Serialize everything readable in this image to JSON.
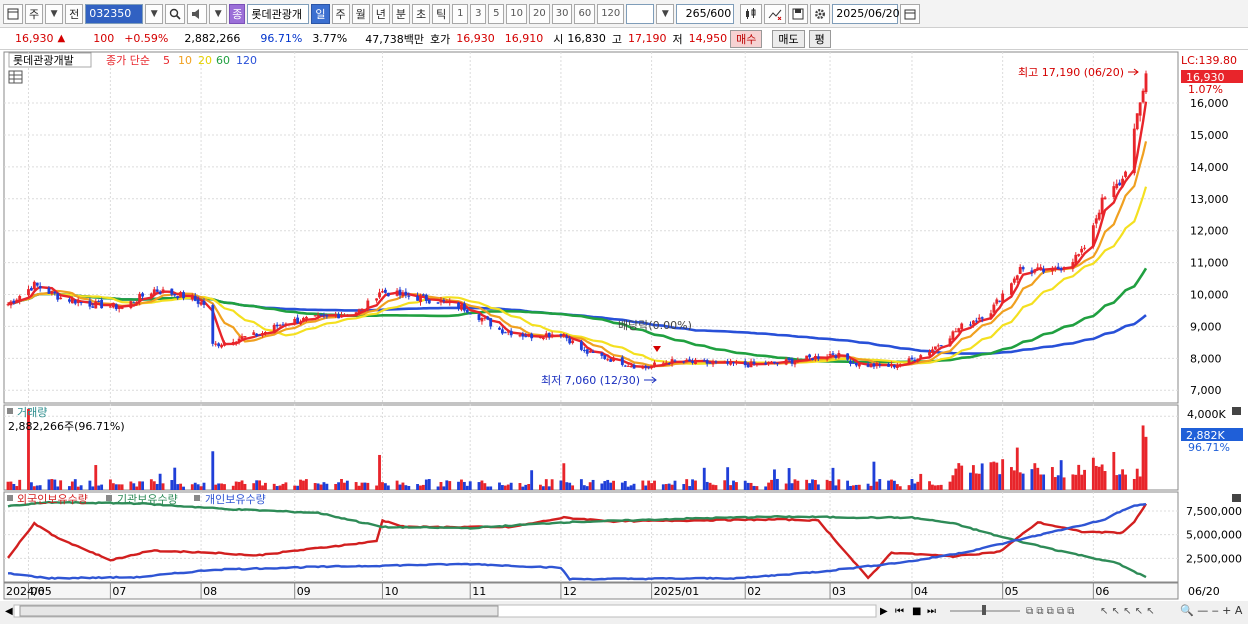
{
  "toolbar": {
    "type_label": "주",
    "prev_label": "전",
    "code": "032350",
    "name_badge": "종",
    "name": "롯데관광개",
    "period_tabs": [
      "일",
      "주",
      "월",
      "년",
      "분",
      "초",
      "틱"
    ],
    "active_period": "일",
    "intervals": [
      "1",
      "3",
      "5",
      "10",
      "20",
      "30",
      "60",
      "120"
    ],
    "count": "265",
    "count_total": "/600",
    "date": "2025/06/20"
  },
  "quote": {
    "price": "16,930",
    "change": "100",
    "change_pct": "+0.59%",
    "volume": "2,882,266",
    "vol_ratio": "96.71%",
    "turnover_rate": "3.77%",
    "trade_value": "47,738백만",
    "ask_label": "호가",
    "ask": "16,930",
    "bid": "16,910",
    "open_label": "시",
    "open": "16,830",
    "high_label": "고",
    "high": "17,190",
    "low_label": "저",
    "low": "14,950",
    "buy_label": "매수",
    "sell_label": "매도",
    "avg_label": "평"
  },
  "colors": {
    "up": "#e8252b",
    "down": "#1f3fd8",
    "ma5": "#e8252b",
    "ma10": "#f0a020",
    "ma20": "#f4e020",
    "ma60": "#20a040",
    "ma120": "#2850d8",
    "foreign": "#d21f1f",
    "institution": "#2e8b57",
    "individual": "#2f55d4"
  },
  "chart_data": [
    {
      "type": "candlestick",
      "legend": {
        "stock": "롯데관광개발",
        "ma_title": "종가 단순",
        "ma_periods": [
          "5",
          "10",
          "20",
          "60",
          "120"
        ]
      },
      "y_ticks": [
        "7,000",
        "8,000",
        "9,000",
        "10,000",
        "11,000",
        "12,000",
        "13,000",
        "14,000",
        "15,000",
        "16,000"
      ],
      "ylim": [
        6600,
        17600
      ],
      "right_labels": {
        "lc": "LC:139.80",
        "price_tag": "16,930",
        "pct": "1.07%"
      },
      "x_ticks": [
        "2024/05",
        "06",
        "07",
        "08",
        "09",
        "10",
        "11",
        "12",
        "2025/01",
        "02",
        "03",
        "04",
        "05",
        "06"
      ],
      "annotations": {
        "high": "최고 17,190 (06/20)",
        "low": "최저 7,060 (12/30)",
        "dividend": "배당락(0.00%)"
      },
      "close_points": [
        [
          "2024/05/27",
          9700
        ],
        [
          "2024/06/05",
          10300
        ],
        [
          "2024/06/14",
          9900
        ],
        [
          "2024/06/24",
          9700
        ],
        [
          "2024/07/05",
          9600
        ],
        [
          "2024/07/16",
          10150
        ],
        [
          "2024/07/26",
          9950
        ],
        [
          "2024/08/02",
          9700
        ],
        [
          "2024/08/05",
          8400
        ],
        [
          "2024/08/12",
          8600
        ],
        [
          "2024/08/21",
          8750
        ],
        [
          "2024/08/30",
          9150
        ],
        [
          "2024/09/10",
          9250
        ],
        [
          "2024/09/25",
          9500
        ],
        [
          "2024/10/01",
          10100
        ],
        [
          "2024/10/10",
          9950
        ],
        [
          "2024/10/21",
          9800
        ],
        [
          "2024/10/31",
          9550
        ],
        [
          "2024/11/11",
          8900
        ],
        [
          "2024/11/21",
          8700
        ],
        [
          "2024/12/02",
          8800
        ],
        [
          "2024/12/10",
          8200
        ],
        [
          "2024/12/20",
          7950
        ],
        [
          "2024/12/30",
          7700
        ],
        [
          "2025/01/08",
          7900
        ],
        [
          "2025/01/20",
          7850
        ],
        [
          "2025/02/03",
          7800
        ],
        [
          "2025/02/14",
          7850
        ],
        [
          "2025/02/25",
          8000
        ],
        [
          "2025/03/05",
          8150
        ],
        [
          "2025/03/14",
          7800
        ],
        [
          "2025/03/25",
          7750
        ],
        [
          "2025/04/01",
          7950
        ],
        [
          "2025/04/08",
          8300
        ],
        [
          "2025/04/18",
          9000
        ],
        [
          "2025/04/28",
          9500
        ],
        [
          "2025/05/08",
          10800
        ],
        [
          "2025/05/19",
          10700
        ],
        [
          "2025/05/29",
          11300
        ],
        [
          "2025/06/05",
          12900
        ],
        [
          "2025/06/12",
          13600
        ],
        [
          "2025/06/17",
          15500
        ],
        [
          "2025/06/20",
          16930
        ]
      ]
    },
    {
      "type": "bar",
      "title": "거래량",
      "value_label": "2,882,266주(96.71%)",
      "y_ticks": [
        "4,000K"
      ],
      "right_labels": {
        "current": "2,882K",
        "pct": "96.71%"
      },
      "ylim": [
        0,
        4500
      ],
      "unit": "K",
      "spikes": [
        [
          "2024/06/03",
          4400
        ],
        [
          "2024/08/05",
          2100
        ],
        [
          "2024/10/01",
          1900
        ],
        [
          "2024/12/03",
          1450
        ],
        [
          "2025/03/05",
          1200
        ],
        [
          "2025/04/22",
          1350
        ],
        [
          "2025/05/07",
          2300
        ],
        [
          "2025/06/02",
          1750
        ],
        [
          "2025/06/19",
          3500
        ],
        [
          "2025/06/20",
          2882
        ]
      ]
    },
    {
      "type": "line",
      "legend": [
        "외국인보유수량",
        "기관보유수량",
        "개인보유수량"
      ],
      "y_ticks": [
        "2,500,000",
        "5,000,000",
        "7,500,000"
      ],
      "ylim": [
        0,
        9500000
      ],
      "series": [
        {
          "name": "외국인보유수량",
          "points": [
            [
              "2024/05/27",
              2600000
            ],
            [
              "2024/06/05",
              6200000
            ],
            [
              "2024/06/12",
              4800000
            ],
            [
              "2024/07/01",
              2300000
            ],
            [
              "2024/07/15",
              3300000
            ],
            [
              "2024/08/05",
              3100000
            ],
            [
              "2024/08/20",
              2800000
            ],
            [
              "2024/09/05",
              3400000
            ],
            [
              "2024/09/30",
              4300000
            ],
            [
              "2024/10/02",
              6500000
            ],
            [
              "2024/10/10",
              5800000
            ],
            [
              "2024/11/15",
              5800000
            ],
            [
              "2024/12/03",
              6800000
            ],
            [
              "2024/12/20",
              6400000
            ],
            [
              "2025/01/15",
              6500000
            ],
            [
              "2025/02/15",
              6600000
            ],
            [
              "2025/02/28",
              6500000
            ],
            [
              "2025/03/10",
              2900000
            ],
            [
              "2025/03/17",
              400000
            ],
            [
              "2025/03/25",
              3100000
            ],
            [
              "2025/04/15",
              2700000
            ],
            [
              "2025/05/01",
              3200000
            ],
            [
              "2025/05/14",
              6300000
            ],
            [
              "2025/05/29",
              5300000
            ],
            [
              "2025/06/12",
              5200000
            ],
            [
              "2025/06/16",
              6400000
            ],
            [
              "2025/06/20",
              8200000
            ]
          ]
        },
        {
          "name": "기관보유수량",
          "points": [
            [
              "2024/05/27",
              8000000
            ],
            [
              "2024/06/10",
              8400000
            ],
            [
              "2024/07/10",
              8300000
            ],
            [
              "2024/08/10",
              7700000
            ],
            [
              "2024/09/10",
              7300000
            ],
            [
              "2024/10/02",
              5800000
            ],
            [
              "2024/11/01",
              5700000
            ],
            [
              "2024/12/03",
              6300000
            ],
            [
              "2025/01/15",
              6700000
            ],
            [
              "2025/02/15",
              6900000
            ],
            [
              "2025/03/15",
              6800000
            ],
            [
              "2025/04/01",
              6800000
            ],
            [
              "2025/04/15",
              6200000
            ],
            [
              "2025/05/01",
              4800000
            ],
            [
              "2025/05/20",
              3400000
            ],
            [
              "2025/06/10",
              2000000
            ],
            [
              "2025/06/20",
              500000
            ]
          ]
        },
        {
          "name": "개인보유수량",
          "points": [
            [
              "2024/05/27",
              900000
            ],
            [
              "2024/06/10",
              400000
            ],
            [
              "2024/07/10",
              500000
            ],
            [
              "2024/08/05",
              1300000
            ],
            [
              "2024/09/10",
              1600000
            ],
            [
              "2024/11/01",
              1900000
            ],
            [
              "2024/12/02",
              1500000
            ],
            [
              "2024/12/05",
              300000
            ],
            [
              "2025/02/01",
              400000
            ],
            [
              "2025/03/01",
              1100000
            ],
            [
              "2025/04/01",
              2200000
            ],
            [
              "2025/04/20",
              3200000
            ],
            [
              "2025/05/15",
              5000000
            ],
            [
              "2025/06/05",
              6500000
            ],
            [
              "2025/06/15",
              8000000
            ],
            [
              "2025/06/20",
              8200000
            ]
          ]
        }
      ]
    }
  ],
  "bottom": {
    "end_date": "06/20"
  }
}
